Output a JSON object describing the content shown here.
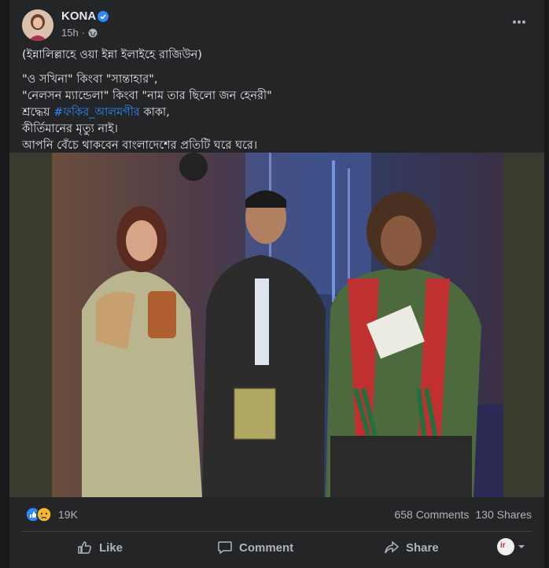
{
  "post": {
    "author": "KONA",
    "time": "15h",
    "lines": [
      "(ইন্নালিল্লাহে ওয়া ইন্না ইলাইহে রাজিউন)",
      "\"ও সখিনা\" কিংবা \"সান্তাহার\",",
      "\"নেলসন ম্যান্ডেলা\" কিংবা \"নাম তার ছিলো জন হেনরী\"",
      "শ্রদ্ধেয়",
      "#ফকির_আলমগীর",
      "কাকা,",
      "কীর্তিমানের মৃত্যু নাই।",
      "আপনি বেঁচে থাকবেন বাংলাদেশের প্রতিটি ঘরে ঘরে।"
    ]
  },
  "stats": {
    "reactions": "19K",
    "comments": "658 Comments",
    "shares": "130 Shares"
  },
  "actions": {
    "like": "Like",
    "comment": "Comment",
    "share": "Share"
  },
  "profile_initials": "ir",
  "icons": {
    "verified": "verified-badge-icon",
    "globe": "globe-icon",
    "more": "more-options-icon",
    "like_reaction": "like-reaction-icon",
    "sad_reaction": "sad-reaction-icon"
  },
  "colors": {
    "background": "#18191a",
    "card": "#242526",
    "text": "#e4e6eb",
    "muted": "#b0b3b8",
    "link": "#2d88ff",
    "verified": "#2d88ff"
  }
}
